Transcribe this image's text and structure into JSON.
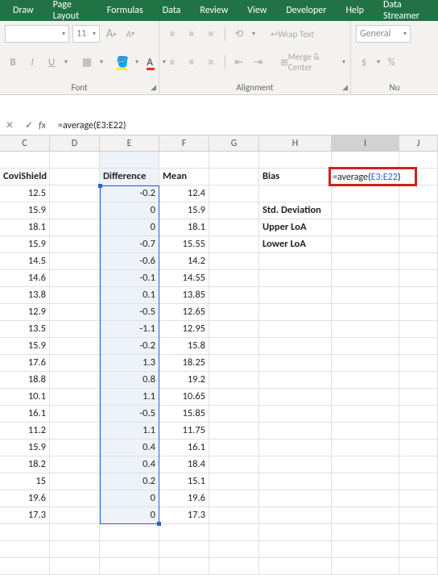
{
  "ribbon": {
    "tabs": [
      "Draw",
      "Page Layout",
      "Formulas",
      "Data",
      "Review",
      "View",
      "Developer",
      "Help",
      "Data Streamer"
    ],
    "font": {
      "name": "",
      "size": "11",
      "incA": "A",
      "decA": "A",
      "bold": "B",
      "italic": "I",
      "underline": "U",
      "group_label": "Font"
    },
    "alignment": {
      "wrap": "Wrap Text",
      "merge": "Merge & Center",
      "group_label": "Alignment"
    },
    "number": {
      "format": "General",
      "currency": "$",
      "percent": "%",
      "group_label": "Nu"
    }
  },
  "fx": {
    "check": "✓",
    "fx": "fx",
    "formula": "=average(E3:E22)"
  },
  "columns": [
    "C",
    "D",
    "E",
    "F",
    "G",
    "H",
    "I",
    "J"
  ],
  "header_row": {
    "C": "CoviShield",
    "E": "Difference",
    "F": "Mean",
    "H": "Bias"
  },
  "side_labels": {
    "std": "Std. Deviation",
    "upper": "Upper LoA",
    "lower": "Lower LoA"
  },
  "edit": {
    "eq": "=",
    "fn": "average(",
    "rng": "E3:E22",
    "close": ")"
  },
  "rows": [
    {
      "C": "12.5",
      "E": "-0.2",
      "F": "12.4"
    },
    {
      "C": "15.9",
      "E": "0",
      "F": "15.9"
    },
    {
      "C": "18.1",
      "E": "0",
      "F": "18.1"
    },
    {
      "C": "15.9",
      "E": "-0.7",
      "F": "15.55"
    },
    {
      "C": "14.5",
      "E": "-0.6",
      "F": "14.2"
    },
    {
      "C": "14.6",
      "E": "-0.1",
      "F": "14.55"
    },
    {
      "C": "13.8",
      "E": "0.1",
      "F": "13.85"
    },
    {
      "C": "12.9",
      "E": "-0.5",
      "F": "12.65"
    },
    {
      "C": "13.5",
      "E": "-1.1",
      "F": "12.95"
    },
    {
      "C": "15.9",
      "E": "-0.2",
      "F": "15.8"
    },
    {
      "C": "17.6",
      "E": "1.3",
      "F": "18.25"
    },
    {
      "C": "18.8",
      "E": "0.8",
      "F": "19.2"
    },
    {
      "C": "10.1",
      "E": "1.1",
      "F": "10.65"
    },
    {
      "C": "16.1",
      "E": "-0.5",
      "F": "15.85"
    },
    {
      "C": "11.2",
      "E": "1.1",
      "F": "11.75"
    },
    {
      "C": "15.9",
      "E": "0.4",
      "F": "16.1"
    },
    {
      "C": "18.2",
      "E": "0.4",
      "F": "18.4"
    },
    {
      "C": "15",
      "E": "0.2",
      "F": "15.1"
    },
    {
      "C": "19.6",
      "E": "0",
      "F": "19.6"
    },
    {
      "C": "17.3",
      "E": "0",
      "F": "17.3"
    }
  ]
}
